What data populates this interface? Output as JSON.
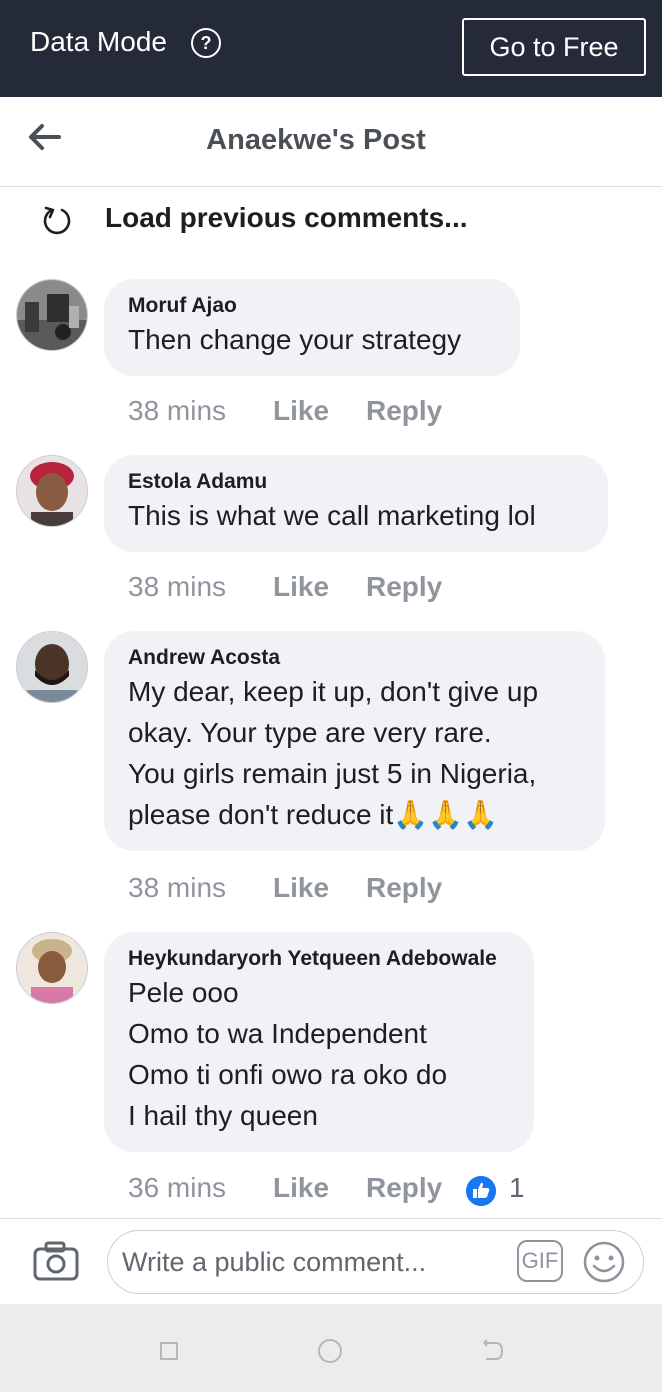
{
  "top_bar": {
    "data_mode_label": "Data Mode",
    "help_glyph": "?",
    "go_free_label": "Go to Free"
  },
  "header": {
    "title": "Anaekwe's Post"
  },
  "load_previous": {
    "label": "Load previous comments..."
  },
  "comments": [
    {
      "author": "Moruf Ajao",
      "text": "Then change your strategy",
      "time": "38 mins",
      "like_label": "Like",
      "reply_label": "Reply"
    },
    {
      "author": "Estola Adamu",
      "text": "This is what we call marketing lol",
      "time": "38 mins",
      "like_label": "Like",
      "reply_label": "Reply"
    },
    {
      "author": "Andrew Acosta",
      "text": "My dear, keep it up, don't give up\nokay. Your type are very rare.\nYou girls remain just 5 in Nigeria,\nplease don't reduce it🙏🙏🙏",
      "time": "38 mins",
      "like_label": "Like",
      "reply_label": "Reply"
    },
    {
      "author": "Heykundaryorh Yetqueen Adebowale",
      "text": "Pele ooo\nOmo to wa Independent\nOmo ti onfi owo ra oko do\nI hail thy queen",
      "time": "36 mins",
      "like_label": "Like",
      "reply_label": "Reply",
      "reaction_count": "1"
    }
  ],
  "composer": {
    "placeholder": "Write a public comment...",
    "gif_label": "GIF"
  },
  "icons": {
    "help": "question-circle-icon",
    "back": "arrow-left-icon",
    "reload": "reload-icon",
    "reaction": "thumbs-up-icon",
    "camera": "camera-icon",
    "gif": "gif-icon",
    "emoji": "smiley-icon",
    "nav_recent": "recent-apps-icon",
    "nav_home": "home-icon",
    "nav_back": "nav-back-icon"
  },
  "colors": {
    "top_bar": "#242a37",
    "bubble": "#f0f2f5",
    "action_text": "#90949c",
    "like_blue": "#1877f2"
  }
}
